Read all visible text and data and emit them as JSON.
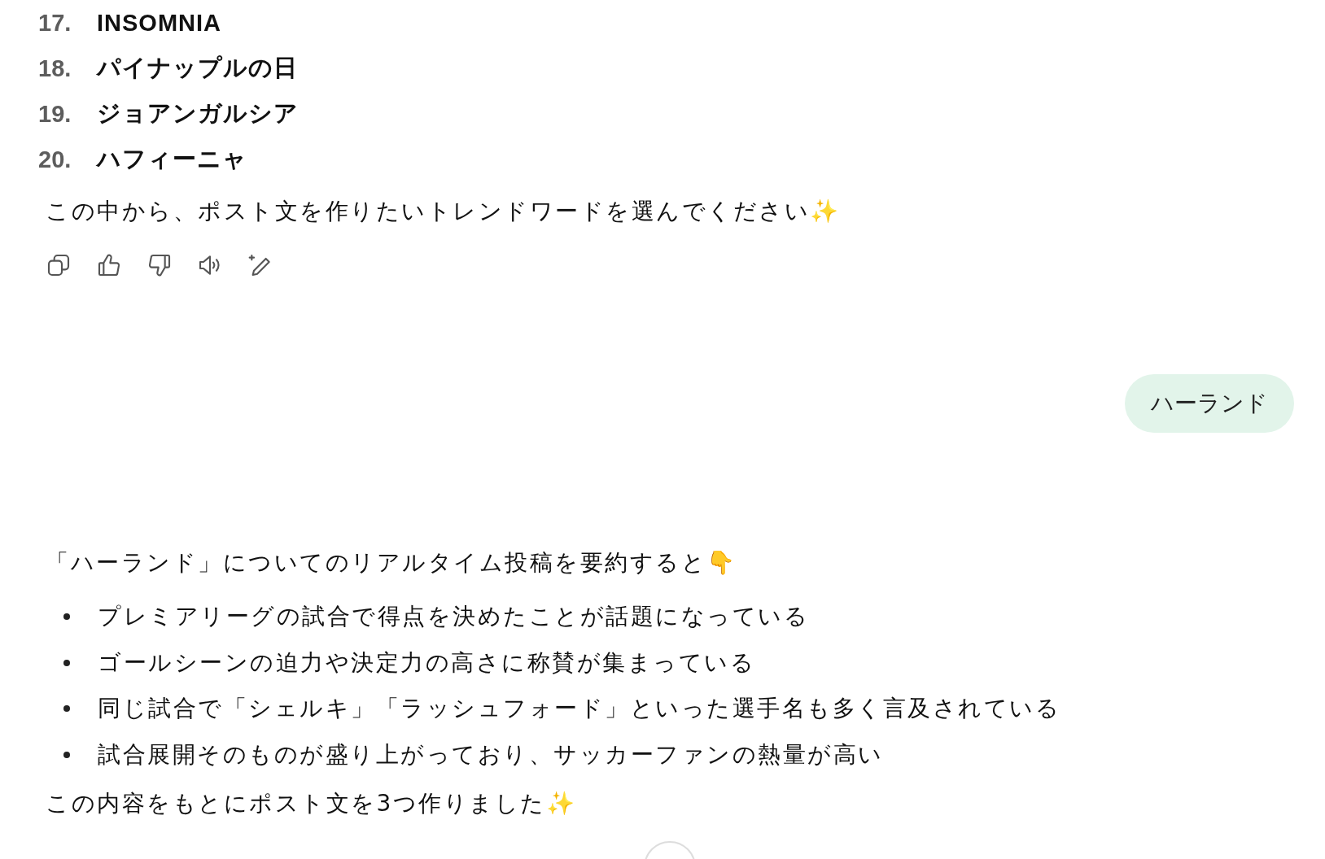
{
  "ranking": [
    {
      "number": "17.",
      "word": "INSOMNIA"
    },
    {
      "number": "18.",
      "word": "パイナップルの日"
    },
    {
      "number": "19.",
      "word": "ジョアンガルシア"
    },
    {
      "number": "20.",
      "word": "ハフィーニャ"
    }
  ],
  "assistant_prompt": "この中から、ポスト文を作りたいトレンドワードを選んでください✨",
  "actions": [
    {
      "kind": "copy"
    },
    {
      "kind": "like"
    },
    {
      "kind": "dislike"
    },
    {
      "kind": "speak"
    },
    {
      "kind": "edit"
    }
  ],
  "user_message": "ハーランド",
  "summary_intro": "「ハーランド」についてのリアルタイム投稿を要約すると👇",
  "summary_points": [
    "プレミアリーグの試合で得点を決めたことが話題になっている",
    "ゴールシーンの迫力や決定力の高さに称賛が集まっている",
    "同じ試合で「シェルキ」「ラッシュフォード」といった選手名も多く言及されている",
    "試合展開そのものが盛り上がっており、サッカーファンの熱量が高い"
  ],
  "closing": "この内容をもとにポスト文を3つ作りました✨"
}
